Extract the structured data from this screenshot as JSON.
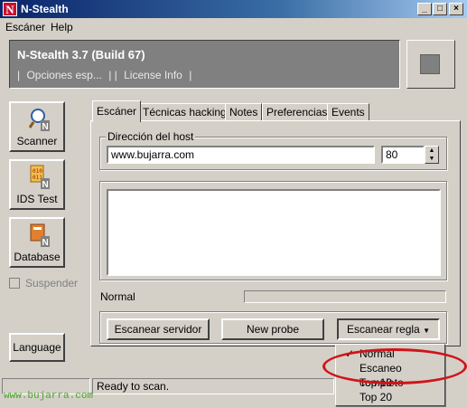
{
  "window": {
    "title": "N-Stealth",
    "app_icon_letter": "N",
    "controls": [
      "_",
      "□",
      "×"
    ]
  },
  "menubar": {
    "items": [
      "Escáner",
      "Help"
    ]
  },
  "header": {
    "title": "N-Stealth 3.7 (Build 67)",
    "links": [
      "Opciones esp...",
      "License Info"
    ]
  },
  "sidebar": {
    "buttons": [
      {
        "label": "Scanner",
        "icon": "scanner-magnifier-icon"
      },
      {
        "label": "IDS Test",
        "icon": "ids-test-icon"
      },
      {
        "label": "Database",
        "icon": "database-icon"
      }
    ],
    "suspend_label": "Suspender",
    "language_label": "Language"
  },
  "tabs": [
    "Escáner",
    "Técnicas hacking",
    "Notes",
    "Preferencias",
    "Events"
  ],
  "scanner": {
    "host_group_label": "Dirección del host",
    "host_value": "www.bujarra.com",
    "port_value": "80",
    "mode_label": "Normal",
    "btn_scan_server": "Escanear servidor",
    "btn_new_probe": "New probe",
    "btn_scan_rule": "Escanear regla"
  },
  "dropdown": {
    "items": [
      "Normal",
      "Escaneo completo",
      "Top 10",
      "Top 20"
    ],
    "checked": "Normal",
    "highlighted": "Escaneo completo"
  },
  "status": {
    "text": "Ready to scan."
  },
  "watermark": "www.bujarra.com",
  "colors": {
    "title_start": "#0a246a",
    "title_end": "#a6caf0",
    "highlight_ellipse": "#d0141a",
    "watermark": "#4aa52a"
  }
}
